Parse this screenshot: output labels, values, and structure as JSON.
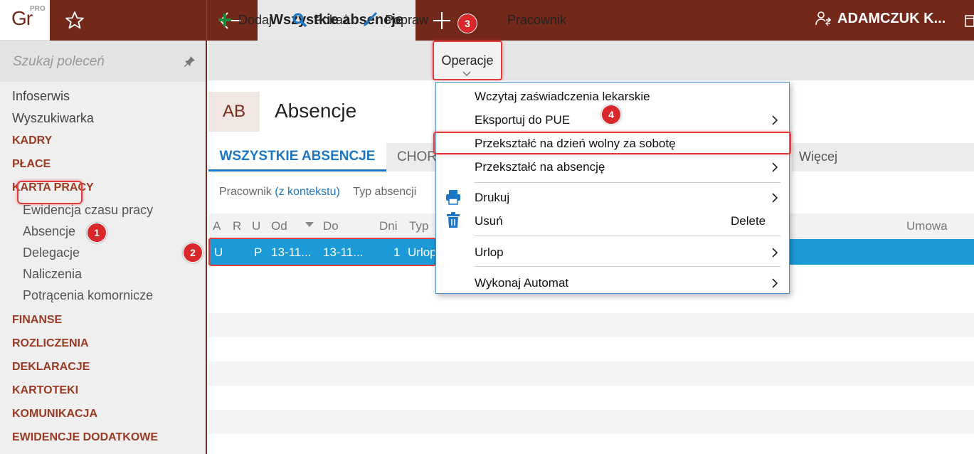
{
  "app": {
    "logo_text": "Gr",
    "logo_badge": "PRO",
    "active_tab": "Wszystkie absencje",
    "user_name": "ADAMCZUK K..."
  },
  "sidebar": {
    "search_placeholder": "Szukaj poleceń",
    "items": [
      {
        "label": "Infoserwis"
      },
      {
        "label": "Wyszukiwarka"
      },
      {
        "label": "KADRY"
      },
      {
        "label": "PŁACE"
      },
      {
        "label": "KARTA PRACY"
      },
      {
        "label": "Ewidencja czasu pracy"
      },
      {
        "label": "Absencje"
      },
      {
        "label": "Delegacje"
      },
      {
        "label": "Naliczenia"
      },
      {
        "label": "Potrącenia komornicze"
      },
      {
        "label": "FINANSE"
      },
      {
        "label": "ROZLICZENIA"
      },
      {
        "label": "DEKLARACJE"
      },
      {
        "label": "KARTOTEKI"
      },
      {
        "label": "KOMUNIKACJA"
      },
      {
        "label": "EWIDENCJE DODATKOWE"
      }
    ]
  },
  "toolbar": {
    "add_label": "Dodaj",
    "show_label": "Pokaż",
    "edit_label": "Popraw",
    "operations_label": "Operacje",
    "employee_label": "Pracownik"
  },
  "header": {
    "tile": "AB",
    "title": "Absencje"
  },
  "tabs": {
    "all": "WSZYSTKIE ABSENCJE",
    "sick": "CHOR",
    "more": "Więcej"
  },
  "filters": {
    "employee": "Pracownik",
    "employee_ctx": "(z kontekstu)",
    "type": "Typ absencji"
  },
  "table": {
    "columns": [
      "A",
      "R",
      "U",
      "Od",
      "Do",
      "Dni",
      "Typ",
      "Umowa"
    ],
    "rows": [
      {
        "A": "U",
        "R": "",
        "U": "P",
        "Od": "13-11...",
        "Do": "13-11...",
        "Dni": "1",
        "Typ": "Urlop"
      }
    ]
  },
  "menu": {
    "items": [
      {
        "label": "Wczytaj zaświadczenia lekarskie"
      },
      {
        "label": "Eksportuj do PUE"
      },
      {
        "label": "Przekształć na dzień wolny za sobotę"
      },
      {
        "label": "Przekształć na absencję"
      },
      {
        "label": "Drukuj"
      },
      {
        "label": "Usuń",
        "shortcut": "Delete"
      },
      {
        "label": "Urlop"
      },
      {
        "label": "Wykonaj Automat"
      }
    ]
  },
  "badges": [
    "1",
    "2",
    "3",
    "4"
  ],
  "colors": {
    "brand": "#74281a",
    "section": "#9b3a22",
    "accent": "#1c77c3",
    "selection": "#1c9ad8",
    "highlight": "#e43c3c"
  }
}
